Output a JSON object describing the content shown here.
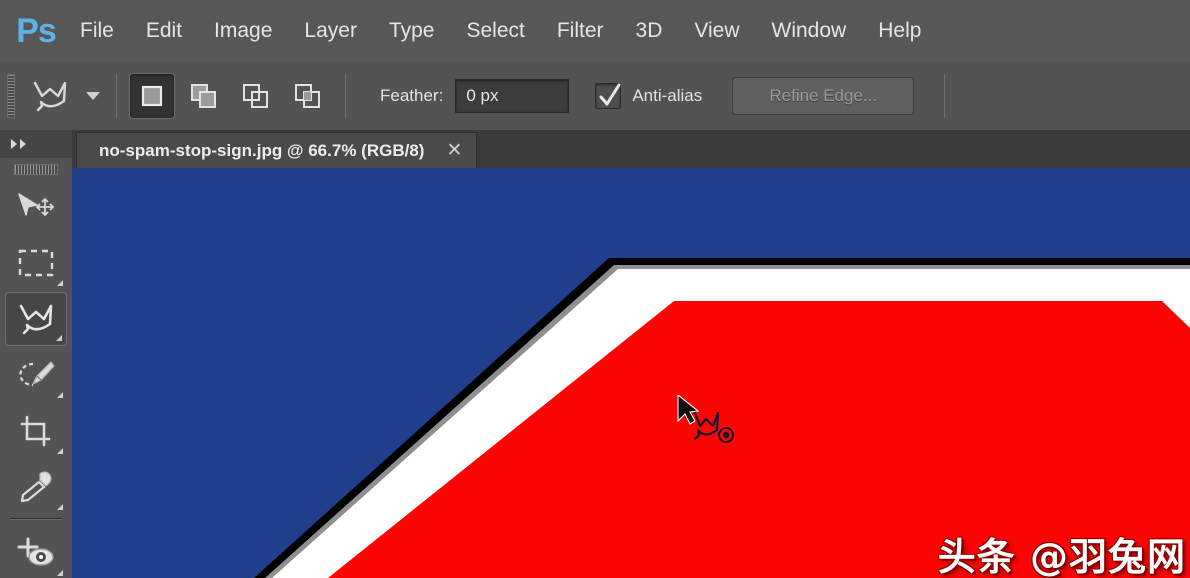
{
  "app": {
    "name": "Photoshop",
    "logo_text": "Ps"
  },
  "menubar": {
    "items": [
      {
        "label": "File"
      },
      {
        "label": "Edit"
      },
      {
        "label": "Image"
      },
      {
        "label": "Layer"
      },
      {
        "label": "Type"
      },
      {
        "label": "Select"
      },
      {
        "label": "Filter"
      },
      {
        "label": "3D"
      },
      {
        "label": "View"
      },
      {
        "label": "Window"
      },
      {
        "label": "Help"
      }
    ]
  },
  "options_bar": {
    "tool_icon": "lasso-tool-icon",
    "tool_preset_caret": "chevron-down-icon",
    "selection_modes": [
      {
        "name": "new-selection",
        "icon": "new-selection-icon",
        "active": true
      },
      {
        "name": "add-to-selection",
        "icon": "add-to-selection-icon",
        "active": false
      },
      {
        "name": "subtract-from-selection",
        "icon": "subtract-from-selection-icon",
        "active": false
      },
      {
        "name": "intersect-selection",
        "icon": "intersect-selection-icon",
        "active": false
      }
    ],
    "feather_label": "Feather:",
    "feather_value": "0 px",
    "feather_placeholder": "0 px",
    "antialias_label": "Anti-alias",
    "antialias_checked": true,
    "refine_edge_label": "Refine Edge...",
    "refine_edge_enabled": false
  },
  "toolbar": {
    "expand_icon": "double-chevron-right-icon",
    "grip": "drag-grip-icon",
    "tools": [
      {
        "name": "move-tool",
        "icon": "move-tool-icon",
        "active": false,
        "has_flyout": false
      },
      {
        "name": "rectangular-marquee-tool",
        "icon": "marquee-tool-icon",
        "active": false,
        "has_flyout": true
      },
      {
        "name": "lasso-tool",
        "icon": "lasso-tool-icon",
        "active": true,
        "has_flyout": true
      },
      {
        "name": "quick-selection-tool",
        "icon": "quick-selection-tool-icon",
        "active": false,
        "has_flyout": true
      },
      {
        "name": "crop-tool",
        "icon": "crop-tool-icon",
        "active": false,
        "has_flyout": true
      },
      {
        "name": "eyedropper-tool",
        "icon": "eyedropper-tool-icon",
        "active": false,
        "has_flyout": true
      },
      {
        "name": "spot-healing-brush-tool",
        "icon": "spot-healing-brush-icon",
        "active": false,
        "has_flyout": true
      }
    ]
  },
  "document": {
    "tab_title": "no-spam-stop-sign.jpg @ 66.7% (RGB/8)",
    "file_name": "no-spam-stop-sign.jpg",
    "zoom": "66.7%",
    "color_mode": "RGB/8",
    "close_icon": "close-icon"
  },
  "canvas": {
    "background_color": "#1f3f8c",
    "sign_red": "#fb0505",
    "sign_white": "#ffffff",
    "sign_outline": "#000000",
    "sign_gray": "#9a9a9a",
    "watermark_text": "头条 @羽兔网",
    "cursor": "lasso-cursor"
  },
  "colors": {
    "chrome": "#535353",
    "menubar": "#575757",
    "tabstrip": "#3a3a3a",
    "accent_blue": "#1f3f86",
    "logo_blue": "#5bb4e5",
    "text": "#e6e6e6"
  }
}
